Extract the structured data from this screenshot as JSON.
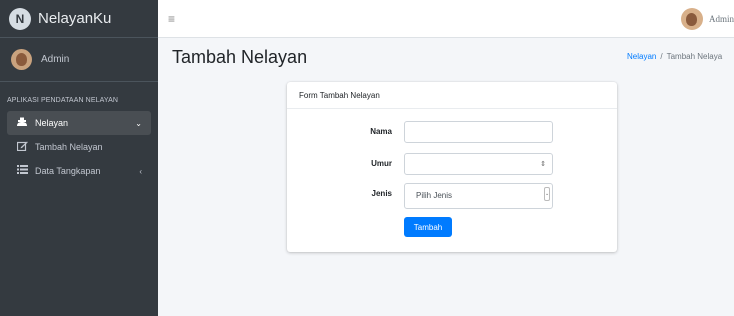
{
  "brand": {
    "name": "NelayanKu",
    "logo_letter": "N"
  },
  "sidebar": {
    "user_name": "Admin",
    "section_header": "APLIKASI PENDATAAN NELAYAN",
    "items": [
      {
        "label": "Nelayan",
        "icon": "user-secret-icon",
        "arrow": "⌄"
      },
      {
        "label": "Tambah Nelayan",
        "icon": "edit-icon"
      },
      {
        "label": "Data Tangkapan",
        "icon": "list-icon",
        "arrow": "‹"
      }
    ]
  },
  "topbar": {
    "menu_icon": "≡",
    "user_name": "Admin"
  },
  "page": {
    "title": "Tambah Nelayan",
    "breadcrumb": {
      "link": "Nelayan",
      "separator": "/",
      "current": "Tambah Nelaya"
    }
  },
  "form": {
    "header": "Form Tambah Nelayan",
    "nama_label": "Nama",
    "nama_value": "",
    "umur_label": "Umur",
    "umur_value": "",
    "jenis_label": "Jenis",
    "jenis_selected": "Pilih Jenis",
    "submit_label": "Tambah"
  },
  "colors": {
    "sidebar": "#343a40",
    "primary": "#007bff",
    "background": "#f4f6f9"
  }
}
